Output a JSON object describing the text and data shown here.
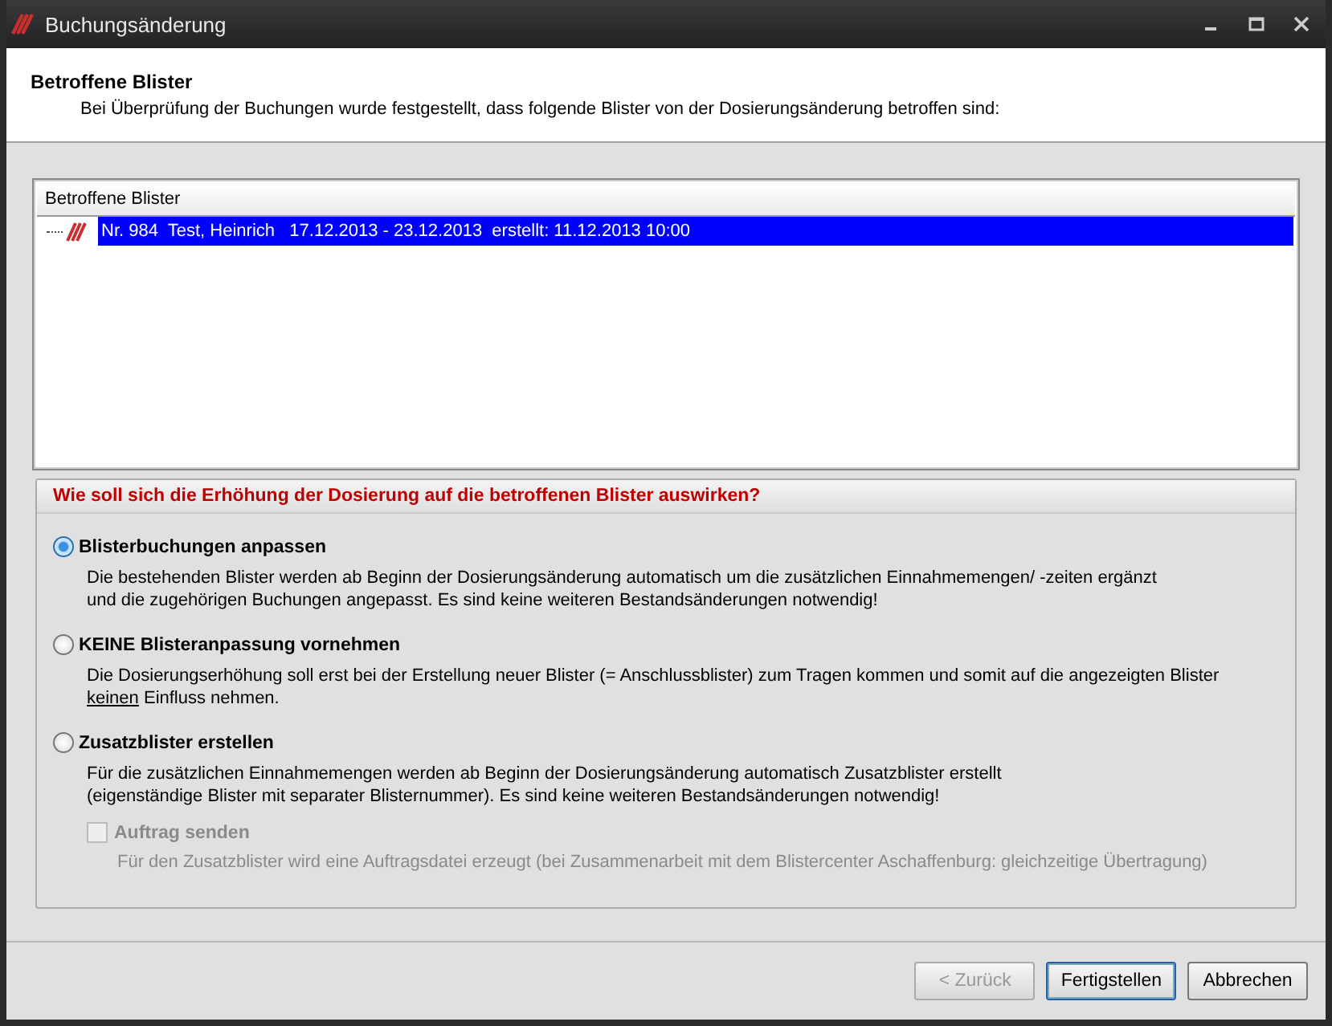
{
  "window": {
    "title": "Buchungsänderung"
  },
  "header": {
    "title": "Betroffene Blister",
    "subtitle": "Bei Überprüfung der Buchungen wurde festgestellt, dass folgende Blister von der Dosierungsänderung betroffen sind:"
  },
  "list": {
    "column": "Betroffene Blister",
    "rows": [
      {
        "text": "Nr. 984  Test, Heinrich   17.12.2013 - 23.12.2013  erstellt: 11.12.2013 10:00",
        "selected": true
      }
    ]
  },
  "group": {
    "title": "Wie soll sich die Erhöhung der Dosierung auf die betroffenen Blister auswirken?",
    "options": [
      {
        "label": "Blisterbuchungen anpassen",
        "selected": true,
        "description": [
          {
            "text": "Die bestehenden Blister werden ab Beginn der Dosierungsänderung automatisch um die zusätzlichen Einnahmemengen/ -zeiten ergänzt\nund die zugehörigen Buchungen angepasst. Es sind keine weiteren Bestandsänderungen notwendig!",
            "underline": false
          }
        ]
      },
      {
        "label": "KEINE Blisteranpassung vornehmen",
        "selected": false,
        "description": [
          {
            "text": "Die Dosierungserhöhung soll erst bei der Erstellung neuer Blister (= Anschlussblister) zum Tragen kommen und somit auf die angezeigten Blister\n",
            "underline": false
          },
          {
            "text": "keinen",
            "underline": true
          },
          {
            "text": " Einfluss nehmen.",
            "underline": false
          }
        ]
      },
      {
        "label": "Zusatzblister erstellen",
        "selected": false,
        "description": [
          {
            "text": "Für die zusätzlichen Einnahmemengen werden ab Beginn der Dosierungsänderung automatisch Zusatzblister erstellt\n(eigenständige Blister mit separater Blisternummer). Es sind keine weiteren Bestandsänderungen notwendig!",
            "underline": false
          }
        ],
        "sub_option": {
          "label": "Auftrag senden",
          "checked": false,
          "disabled": true,
          "description": "Für den Zusatzblister wird eine Auftragsdatei erzeugt (bei Zusammenarbeit mit dem Blistercenter Aschaffenburg: gleichzeitige Übertragung)"
        }
      }
    ]
  },
  "buttons": [
    {
      "label": "< Zurück",
      "disabled": true,
      "default": false
    },
    {
      "label": "Fertigstellen",
      "disabled": false,
      "default": true
    },
    {
      "label": "Abbrechen",
      "disabled": false,
      "default": false
    }
  ]
}
